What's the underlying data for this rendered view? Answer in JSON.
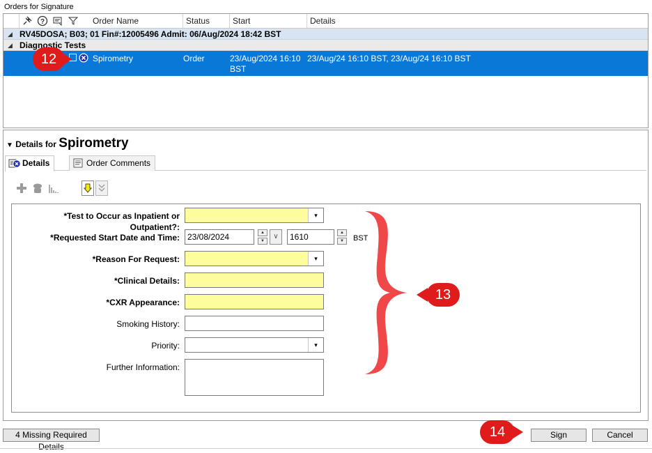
{
  "window": {
    "title": "Orders for Signature"
  },
  "grid": {
    "columns": [
      "Order Name",
      "Status",
      "Start",
      "Details"
    ],
    "header_icons": [
      "pin-icon",
      "help-icon",
      "comment-icon",
      "filter-icon"
    ],
    "group_label": "RV45DOSA; B03; 01  Fin#:12005496  Admit: 06/Aug/2024 18:42 BST",
    "subgroup_label": "Diagnostic Tests",
    "row": {
      "order_name": "Spirometry",
      "status": "Order",
      "start_line1": "23/Aug/2024 16:10",
      "start_line2": "BST",
      "details": "23/Aug/24 16:10 BST, 23/Aug/24 16:10 BST"
    }
  },
  "details": {
    "prefix": "Details for",
    "title": "Spirometry",
    "tabs": [
      "Details",
      "Order Comments"
    ],
    "fields": {
      "test_occur_label": "*Test to Occur as Inpatient or Outpatient?:",
      "test_occur_value": "",
      "start_label": "*Requested Start Date and Time:",
      "start_date": "23/08/2024",
      "start_time": "1610",
      "timezone": "BST",
      "reason_label": "*Reason For Request:",
      "reason_value": "",
      "clinical_label": "*Clinical Details:",
      "clinical_value": "",
      "cxr_label": "*CXR Appearance:",
      "cxr_value": "",
      "smoking_label": "Smoking History:",
      "smoking_value": "",
      "priority_label": "Priority:",
      "priority_value": "",
      "further_label": "Further Information:",
      "further_value": ""
    }
  },
  "footer": {
    "missing": "4 Missing Required Details",
    "sign": "Sign",
    "cancel": "Cancel"
  },
  "callouts": {
    "c12": "12",
    "c13": "13",
    "c14": "14"
  },
  "colors": {
    "selection": "#0a78d7",
    "required_field": "#fdfd9e",
    "callout": "#e01b1b",
    "group_row": "#d8e4f1"
  }
}
